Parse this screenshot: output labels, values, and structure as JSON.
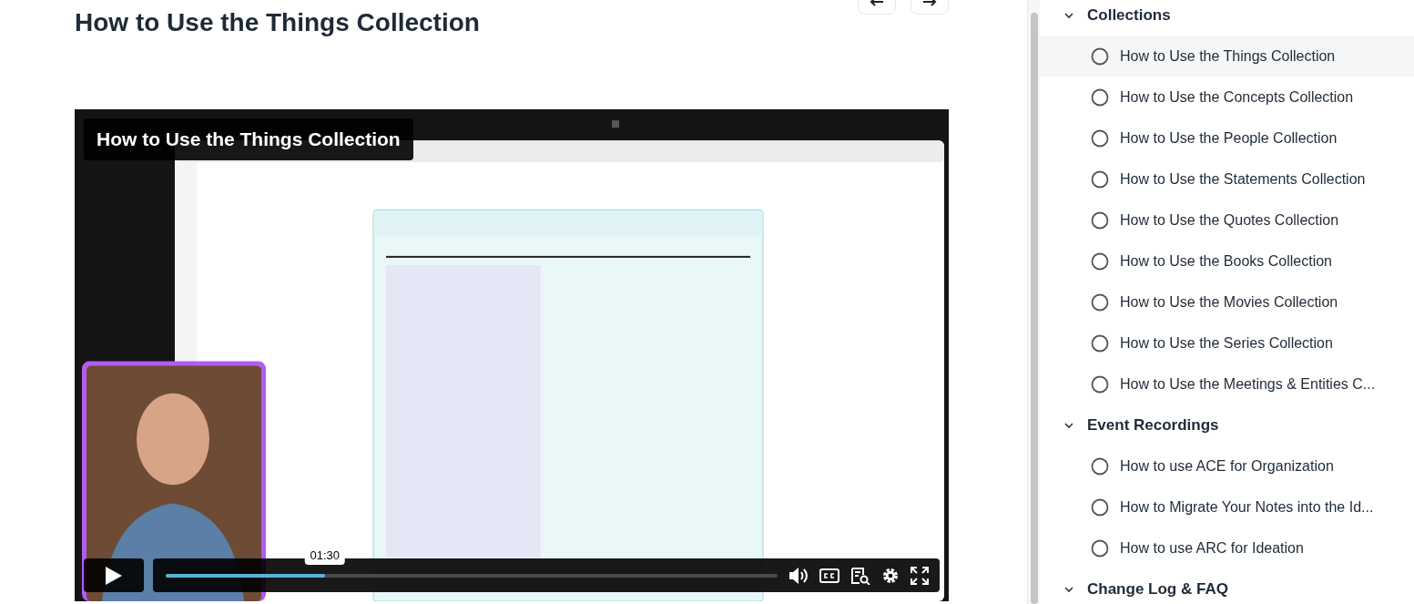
{
  "page": {
    "title": "How to Use the Things Collection"
  },
  "video": {
    "kind": "picture",
    "overlay_title": "How to Use the Things Collection",
    "time_tooltip": "01:30",
    "level": 0.26,
    "playing": false
  },
  "sidebar": {
    "groups": [
      {
        "title": "Collections",
        "expanded": true,
        "lessons": [
          {
            "title": "How to Use the Things Collection",
            "selected": true,
            "completed": false
          },
          {
            "title": "How to Use the Concepts Collection",
            "selected": false,
            "completed": false
          },
          {
            "title": "How to Use the People Collection",
            "selected": false,
            "completed": false
          },
          {
            "title": "How to Use the Statements Collection",
            "selected": false,
            "completed": false
          },
          {
            "title": "How to Use the Quotes Collection",
            "selected": false,
            "completed": false
          },
          {
            "title": "How to Use the Books Collection",
            "selected": false,
            "completed": false
          },
          {
            "title": "How to Use the Movies Collection",
            "selected": false,
            "completed": false
          },
          {
            "title": "How to Use the Series Collection",
            "selected": false,
            "completed": false
          },
          {
            "title": "How to Use the Meetings & Entities C...",
            "selected": false,
            "completed": false
          }
        ]
      },
      {
        "title": "Event Recordings",
        "expanded": true,
        "lessons": [
          {
            "title": "How to use ACE for Organization",
            "selected": false,
            "completed": false
          },
          {
            "title": "How to Migrate Your Notes into the Id...",
            "selected": false,
            "completed": false
          },
          {
            "title": "How to use ARC for Ideation",
            "selected": false,
            "completed": false
          }
        ]
      },
      {
        "title": "Change Log & FAQ",
        "expanded": true
      }
    ]
  }
}
